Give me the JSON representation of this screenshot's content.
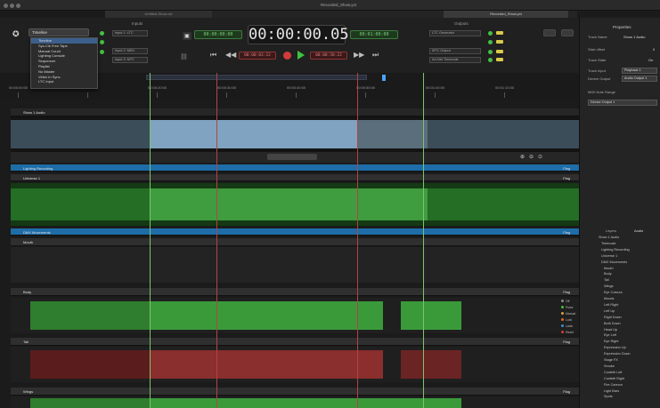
{
  "window": {
    "title": "Recorded_Show.yxt",
    "tabs": [
      "Untitled-Show.xsf",
      "Recorded_Show.yxt"
    ],
    "active_tab": 1
  },
  "input_panel": {
    "title": "Inputs",
    "selected_source": "Timeline",
    "source_options": [
      "Timeline",
      "Sys-Clk Free Tape",
      "Manual Count",
      "Lighting Console",
      "Sequencer",
      "Playlist",
      "No Master",
      "Video In Sync",
      "LTC Input"
    ],
    "selected_index": 0,
    "fields": [
      "Input 1: LTC",
      "Input 2: MIDI",
      "Input 3: MTC"
    ]
  },
  "timecode": {
    "main": "00:00:00.05",
    "left_small": "00:00:00:00",
    "right_small": "00:01:00:00",
    "loop_in": "00:00:03:12",
    "loop_out": "00:00:58:22"
  },
  "output_panel": {
    "title": "Outputs",
    "fields": [
      "LTC Generator",
      "MTC Output",
      "Art-Net Timecode"
    ]
  },
  "properties": {
    "title": "Properties",
    "rows": [
      {
        "label": "Track Name",
        "value": "Show 1 Audio"
      },
      {
        "label": "Start offset",
        "value": "0"
      },
      {
        "label": "Track State",
        "value": "On"
      },
      {
        "label": "Track Input",
        "value": "Playback 1"
      },
      {
        "label": "Device Output",
        "value": "Audio Output 1"
      }
    ],
    "midi_label": "MIDI Note Range",
    "dropdown_value": "Device Output 1"
  },
  "tree": {
    "tabs": [
      "Layers",
      "Audio"
    ],
    "items": [
      "Show 1 Audio",
      "Timecode",
      "Lighting Recording",
      "Universe 1",
      "DMX Movements",
      "Mouth",
      "Body",
      "Tail",
      "Wings",
      "Eye Colours",
      "Moods",
      "Left Right",
      "Left Up",
      "Right Down",
      "Both Down",
      "Head Up",
      "Eye Left",
      "Eye Right",
      "Expression Up",
      "Expression Down",
      "Stage FX",
      "Smoke",
      "Confetti Left",
      "Confetti Right",
      "Fire Cannon",
      "Light Bars",
      "Spots"
    ]
  },
  "tracks": [
    {
      "name": "Show 1 Audio",
      "type": "audio"
    },
    {
      "name": "Lighting Recording",
      "type": "section",
      "flag": "Flag"
    },
    {
      "name": "Universe 1",
      "type": "lighting",
      "flag": "Flag"
    },
    {
      "name": "DMX Movements",
      "type": "section",
      "flag": "Flag"
    },
    {
      "name": "Mouth",
      "type": "dmx",
      "flag": "Flag"
    },
    {
      "name": "Body",
      "type": "dmx",
      "flag": "Flag"
    },
    {
      "name": "Tail",
      "type": "dmx",
      "flag": "Flag"
    },
    {
      "name": "Wings",
      "type": "dmx",
      "flag": "Flag"
    }
  ],
  "flags_legend": [
    "Off",
    "Pulse",
    "Manual",
    "Lock",
    "Latch",
    "Reset"
  ],
  "ruler_labels": [
    "00:00:00:00",
    "00:00:10:00",
    "00:00:20:00",
    "00:00:30:00",
    "00:00:40:00",
    "00:00:50:00",
    "00:01:00:00",
    "00:01:10:00"
  ],
  "colors": {
    "accent_blue": "#1e6da8",
    "wave_green": "#2f7d2f",
    "wave_red": "#7a2626",
    "audio_blue": "#7fa3c0"
  }
}
